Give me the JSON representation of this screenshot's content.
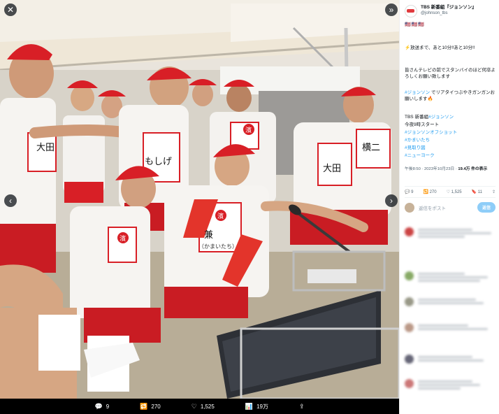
{
  "colors": {
    "accent": "#1d9bf0",
    "shirt_red": "#d81f26"
  },
  "photo": {
    "alt": "Men in red gym caps and white gym shirts with name bibs at a sports day tent, gathered around a monitor and microphone",
    "bibs": [
      "濱",
      "濱",
      "濱",
      "濱",
      "濱"
    ],
    "names": [
      "大田",
      "横二",
      "もしげ",
      "兼"
    ],
    "sub_label": "（かまいたち）",
    "nav_left": "‹",
    "nav_right": "›",
    "close": "✕",
    "expand": "»"
  },
  "bottom_bar": {
    "replies": "9",
    "retweets": "270",
    "likes": "1,525",
    "views": "19万"
  },
  "sidebar": {
    "account_name": "TBS 新番組『ジョンソン』",
    "account_handle": "@johnson_tbs",
    "flags": "🇺🇸🇺🇸🇺🇸",
    "line1": "⚡放送まで、あと10分‼あと10分‼",
    "line2": "皆さんテレビの前でスタンバイのほど何卒よろしくお願い致します",
    "line3_hashtag": "#ジョンソン",
    "line3_rest": "でリアタイつぶやきガンガンお願いします🔥",
    "line4": "TBS 新番組",
    "line4_hashtag": "#ジョンソン",
    "line5": "今夜9時スタート",
    "tag1": "#ジョンソンオフショット",
    "tag2": "#かまいたち",
    "tag3": "#見取り図",
    "tag4": "#ニューヨーク",
    "meta_time": "午後8:50 · 2023年10月23日 ·",
    "meta_views": "19.4万 件の表示",
    "stat_replies": "9",
    "stat_retweets": "270",
    "stat_likes": "1,525",
    "stat_bookmarks": "11",
    "reply_placeholder": "返信をポスト",
    "reply_button": "返信"
  }
}
